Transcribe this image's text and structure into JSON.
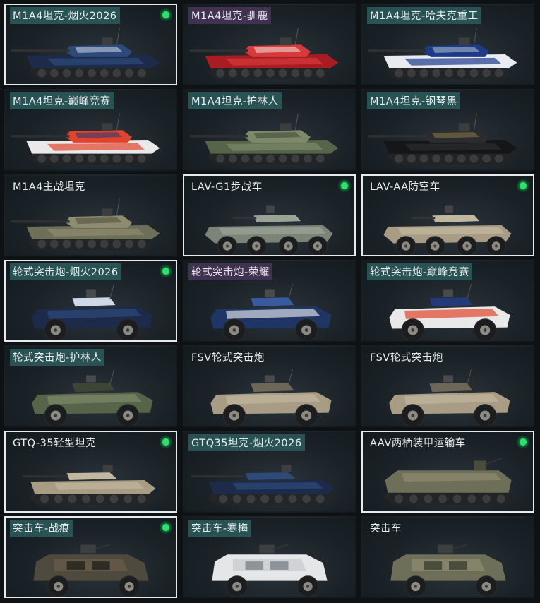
{
  "colors": {
    "card_bg": "#1b2227",
    "selected_border": "#e6eaec",
    "owned_dot": "#2fe06f",
    "tag_teal": "#2c5c5c",
    "tag_purple": "#463456"
  },
  "cards": [
    {
      "name": "M1A4坦克-烟火2026",
      "type": "tank",
      "skin": "navy-2026",
      "owned": true,
      "selected": true,
      "tag": "teal"
    },
    {
      "name": "M1A4坦克-驯鹿",
      "type": "tank",
      "skin": "red",
      "owned": false,
      "selected": false,
      "tag": "purple"
    },
    {
      "name": "M1A4坦克-哈夫克重工",
      "type": "tank",
      "skin": "white-blue",
      "owned": false,
      "selected": false,
      "tag": "teal"
    },
    {
      "name": "M1A4坦克-巅峰竞赛",
      "type": "tank",
      "skin": "race",
      "owned": false,
      "selected": false,
      "tag": "teal"
    },
    {
      "name": "M1A4坦克-护林人",
      "type": "tank",
      "skin": "camo",
      "owned": false,
      "selected": false,
      "tag": "teal"
    },
    {
      "name": "M1A4坦克-钢琴黑",
      "type": "tank",
      "skin": "black",
      "owned": false,
      "selected": false,
      "tag": "teal"
    },
    {
      "name": "M1A4主战坦克",
      "type": "tank",
      "skin": "olive",
      "owned": false,
      "selected": false,
      "tag": "plain"
    },
    {
      "name": "LAV-G1步战车",
      "type": "lav",
      "skin": "grey-green",
      "owned": true,
      "selected": true,
      "tag": "plain"
    },
    {
      "name": "LAV-AA防空车",
      "type": "lav",
      "skin": "tan",
      "owned": true,
      "selected": true,
      "tag": "plain"
    },
    {
      "name": "轮式突击炮-烟火2026",
      "type": "wheeled",
      "skin": "navy-2026",
      "owned": true,
      "selected": true,
      "tag": "teal"
    },
    {
      "name": "轮式突击炮-荣耀",
      "type": "wheeled",
      "skin": "navy-white",
      "owned": false,
      "selected": false,
      "tag": "purple"
    },
    {
      "name": "轮式突击炮-巅峰竞赛",
      "type": "wheeled",
      "skin": "race",
      "owned": false,
      "selected": false,
      "tag": "teal"
    },
    {
      "name": "轮式突击炮-护林人",
      "type": "wheeled",
      "skin": "camo",
      "owned": false,
      "selected": false,
      "tag": "teal"
    },
    {
      "name": "FSV轮式突击炮",
      "type": "wheeled",
      "skin": "tan",
      "owned": false,
      "selected": false,
      "tag": "plain"
    },
    {
      "name": "FSV轮式突击炮",
      "type": "wheeled",
      "skin": "tan",
      "owned": false,
      "selected": false,
      "tag": "plain"
    },
    {
      "name": "GTQ-35轻型坦克",
      "type": "light",
      "skin": "tan",
      "owned": true,
      "selected": true,
      "tag": "plain"
    },
    {
      "name": "GTQ35坦克-烟火2026",
      "type": "light",
      "skin": "navy-2026",
      "owned": false,
      "selected": false,
      "tag": "teal"
    },
    {
      "name": "AAV两栖装甲运输车",
      "type": "aav",
      "skin": "olive",
      "owned": true,
      "selected": true,
      "tag": "plain"
    },
    {
      "name": "突击车-战痕",
      "type": "assault",
      "skin": "rust",
      "owned": true,
      "selected": true,
      "tag": "teal"
    },
    {
      "name": "突击车-寒梅",
      "type": "assault",
      "skin": "white",
      "owned": false,
      "selected": false,
      "tag": "teal"
    },
    {
      "name": "突击车",
      "type": "assault",
      "skin": "olive",
      "owned": false,
      "selected": false,
      "tag": "plain"
    }
  ],
  "skin_palettes": {
    "navy-2026": [
      "#1d2a4a",
      "#2d4a7a",
      "#cfd8e6"
    ],
    "red": [
      "#a81d23",
      "#d63a3a",
      "#f1e6de"
    ],
    "white-blue": [
      "#e8ecf0",
      "#1e3b8a",
      "#b8c2cc"
    ],
    "race": [
      "#e9e9e9",
      "#e0442c",
      "#233a7a"
    ],
    "camo": [
      "#56644a",
      "#7d8a6a",
      "#3d4635"
    ],
    "black": [
      "#151617",
      "#2a2c2e",
      "#8a7a4a"
    ],
    "olive": [
      "#6e6f58",
      "#8d8b70",
      "#4a4c3c"
    ],
    "grey-green": [
      "#7a8578",
      "#9aa396",
      "#4c5450"
    ],
    "tan": [
      "#a89c84",
      "#c2b79f",
      "#6e6656"
    ],
    "navy-white": [
      "#1f3566",
      "#d9dde3",
      "#3a5aa0"
    ],
    "rust": [
      "#4e4a3e",
      "#6a5c48",
      "#2e2c26"
    ],
    "white": [
      "#e4e6e8",
      "#c9ccd0",
      "#8e949a"
    ]
  },
  "icons": {
    "owned": "green-dot-icon"
  }
}
